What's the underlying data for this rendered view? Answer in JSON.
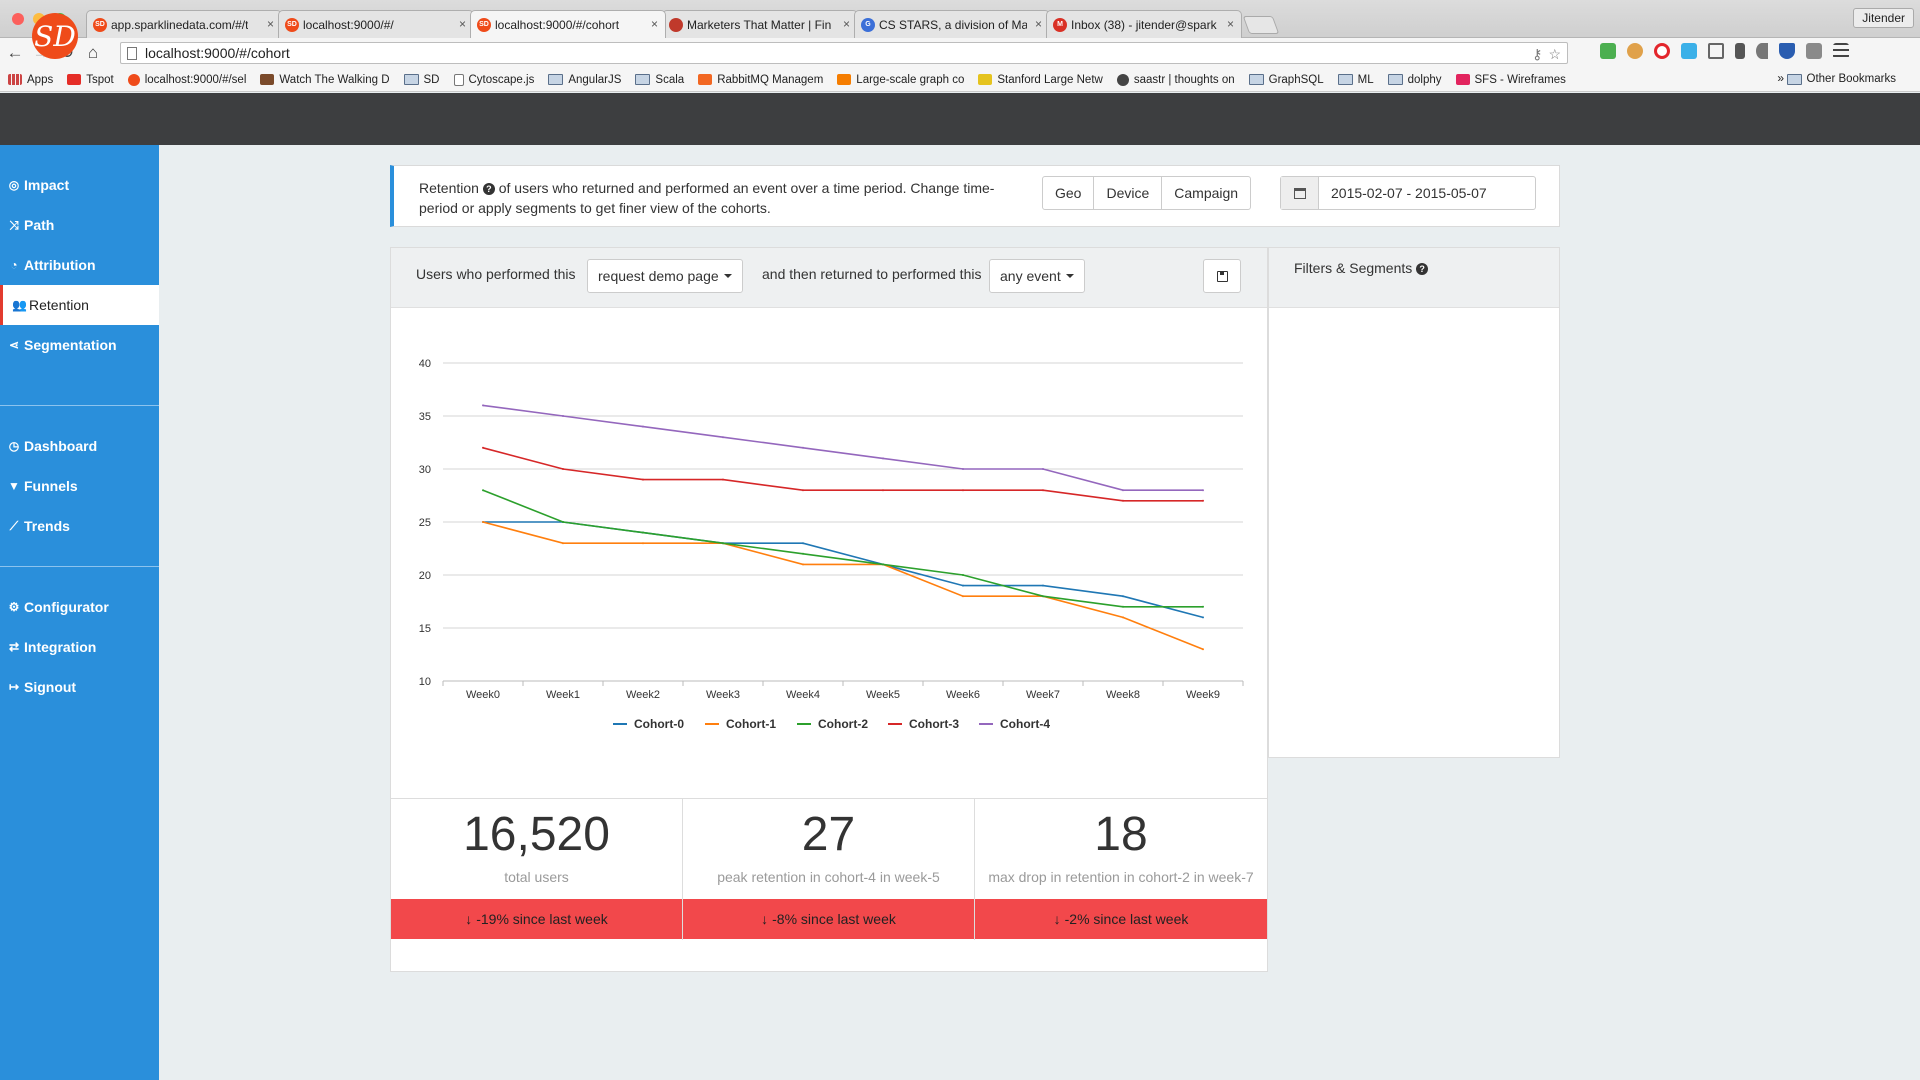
{
  "browser": {
    "tabs": [
      {
        "label": "app.sparklinedata.com/#/t",
        "fav": "#ef4b1a",
        "favtext": "SD"
      },
      {
        "label": "localhost:9000/#/",
        "fav": "#ef4b1a",
        "favtext": "SD"
      },
      {
        "label": "localhost:9000/#/cohort",
        "fav": "#ef4b1a",
        "favtext": "SD",
        "active": true
      },
      {
        "label": "Marketers That Matter | Fin",
        "fav": "#c0392b",
        "favtext": ""
      },
      {
        "label": "CS STARS, a division of Ma",
        "fav": "#3b6fd8",
        "favtext": "G"
      },
      {
        "label": "Inbox (38) - jitender@spark",
        "fav": "#d93025",
        "favtext": "M"
      }
    ],
    "profile": "Jitender",
    "url": "localhost:9000/#/cohort",
    "bookmarks": [
      {
        "label": "Apps",
        "type": "apps"
      },
      {
        "label": "Tspot",
        "type": "yt"
      },
      {
        "label": "localhost:9000/#/sel",
        "type": "sd"
      },
      {
        "label": "Watch The Walking D",
        "type": "film"
      },
      {
        "label": "SD",
        "type": "folder"
      },
      {
        "label": "Cytoscape.js",
        "type": "page"
      },
      {
        "label": "AngularJS",
        "type": "folder"
      },
      {
        "label": "Scala",
        "type": "folder"
      },
      {
        "label": "RabbitMQ Managem",
        "type": "rabbit"
      },
      {
        "label": "Large-scale graph co",
        "type": "blogger"
      },
      {
        "label": "Stanford Large Netw",
        "type": "stanford"
      },
      {
        "label": "saastr | thoughts on",
        "type": "saastr"
      },
      {
        "label": "GraphSQL",
        "type": "folder"
      },
      {
        "label": "ML",
        "type": "folder"
      },
      {
        "label": "dolphy",
        "type": "folder"
      },
      {
        "label": "SFS - Wireframes",
        "type": "invision"
      }
    ],
    "bookmarks_more": "»",
    "other_bookmarks": "Other Bookmarks"
  },
  "app": {
    "logo": "SD",
    "nav": [
      {
        "label": "Impact",
        "icon": "◎",
        "name": "impact"
      },
      {
        "label": "Path",
        "icon": "⤨",
        "name": "path"
      },
      {
        "label": "Attribution",
        "icon": "◔",
        "name": "attribution"
      },
      {
        "label": "Retention",
        "icon": "👥",
        "name": "retention",
        "active": true
      },
      {
        "label": "Segmentation",
        "icon": "⋖",
        "name": "segmentation"
      },
      {
        "label": "Dashboard",
        "icon": "◷",
        "name": "dashboard"
      },
      {
        "label": "Funnels",
        "icon": "▼",
        "name": "funnels"
      },
      {
        "label": "Trends",
        "icon": "⟋",
        "name": "trends"
      },
      {
        "label": "Configurator",
        "icon": "⚙",
        "name": "configurator"
      },
      {
        "label": "Integration",
        "icon": "⇄",
        "name": "integration"
      },
      {
        "label": "Signout",
        "icon": "↦",
        "name": "signout"
      }
    ]
  },
  "info": {
    "title": "Retention",
    "text": "of users who returned and performed an event over a time period. Change time-period or apply segments to get finer view of the cohorts.",
    "segments": [
      "Geo",
      "Device",
      "Campaign"
    ],
    "date_range": "2015-02-07 - 2015-05-07"
  },
  "query": {
    "label1": "Users who performed this",
    "event1": "request demo page",
    "label2": "and then returned to performed this",
    "event2": "any event"
  },
  "filters": {
    "title": "Filters & Segments"
  },
  "chart_data": {
    "type": "line",
    "categories": [
      "Week0",
      "Week1",
      "Week2",
      "Week3",
      "Week4",
      "Week5",
      "Week6",
      "Week7",
      "Week8",
      "Week9"
    ],
    "ylim": [
      10,
      40
    ],
    "yticks": [
      10,
      15,
      20,
      25,
      30,
      35,
      40
    ],
    "grid": true,
    "legend": "bottom",
    "series": [
      {
        "name": "Cohort-0",
        "color": "#1f77b4",
        "values": [
          25,
          25,
          24,
          23,
          23,
          21,
          19,
          19,
          18,
          16
        ]
      },
      {
        "name": "Cohort-1",
        "color": "#ff7f0e",
        "values": [
          25,
          23,
          23,
          23,
          21,
          21,
          18,
          18,
          16,
          13
        ]
      },
      {
        "name": "Cohort-2",
        "color": "#2ca02c",
        "values": [
          28,
          25,
          24,
          23,
          22,
          21,
          20,
          18,
          17,
          17
        ]
      },
      {
        "name": "Cohort-3",
        "color": "#d62728",
        "values": [
          32,
          30,
          29,
          29,
          28,
          28,
          28,
          28,
          27,
          27
        ]
      },
      {
        "name": "Cohort-4",
        "color": "#9467bd",
        "values": [
          36,
          35,
          34,
          33,
          32,
          31,
          30,
          30,
          28,
          28
        ]
      }
    ]
  },
  "stats": [
    {
      "value": "16,520",
      "label": "total users",
      "delta": "-19% since last week"
    },
    {
      "value": "27",
      "label": "peak retention in cohort-4 in week-5",
      "delta": "-8% since last week"
    },
    {
      "value": "18",
      "label": "max drop in retention in cohort-2 in week-7",
      "delta": "-2% since last week"
    }
  ]
}
